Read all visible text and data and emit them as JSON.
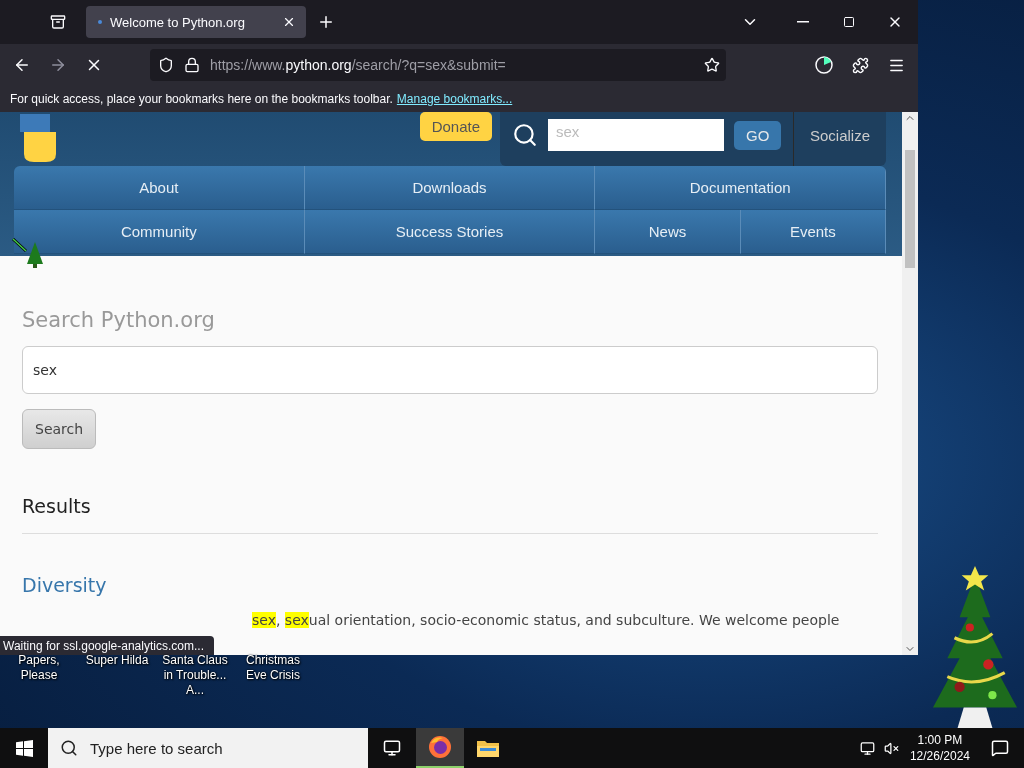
{
  "browser": {
    "tabs": [
      {
        "title": "Welcome to Python.org",
        "selected": true
      }
    ],
    "url": {
      "prefix": "https://www.",
      "host": "python.org",
      "path": "/search/?q=sex&submit="
    },
    "bookmarks_bar": {
      "text": "For quick access, place your bookmarks here on the bookmarks toolbar.",
      "link": "Manage bookmarks..."
    },
    "status": "Waiting for ssl.google-analytics.com..."
  },
  "site_header": {
    "donate": "Donate",
    "search_value": "sex",
    "go": "GO",
    "socialize": "Socialize"
  },
  "nav": [
    [
      {
        "label": "About"
      },
      {
        "label": "Downloads"
      },
      {
        "label": "Documentation"
      }
    ],
    [
      {
        "label": "Community"
      },
      {
        "label": "Success Stories"
      },
      {
        "label": "News"
      },
      {
        "label": "Events"
      }
    ]
  ],
  "search": {
    "heading": "Search Python.org",
    "value": "sex",
    "button": "Search"
  },
  "results": {
    "heading": "Results",
    "items": [
      {
        "title": "Diversity",
        "snippet": [
          {
            "text": "sex",
            "highlight": true
          },
          {
            "text": ", ",
            "highlight": false
          },
          {
            "text": "sex",
            "highlight": true
          },
          {
            "text": "ual orientation, socio-economic status, and subculture. We welcome people",
            "highlight": false
          }
        ]
      }
    ]
  },
  "desktop_icons": [
    {
      "label": "Papers, Please"
    },
    {
      "label": "Super Hilda"
    },
    {
      "label": "Santa Claus in Trouble... A..."
    },
    {
      "label": "Christmas Eve Crisis"
    }
  ],
  "taskbar": {
    "search_placeholder": "Type here to search",
    "apps": [
      {
        "kind": "firefox",
        "selected": true
      },
      {
        "kind": "explorer",
        "selected": false
      }
    ],
    "time": "1:00 PM",
    "date": "12/26/2024"
  }
}
